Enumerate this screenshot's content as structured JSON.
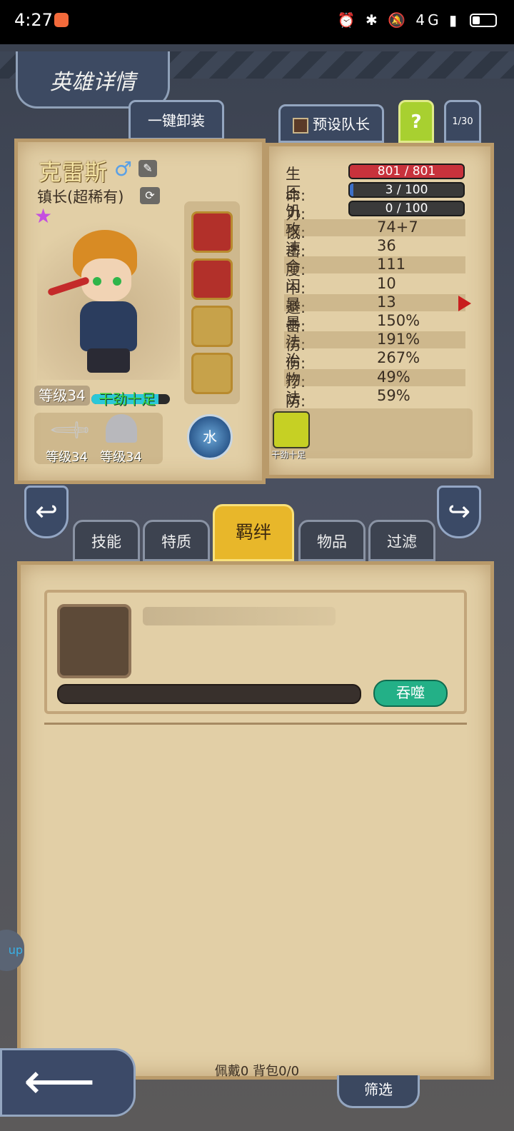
{
  "status_bar": {
    "time": "4:27",
    "icons": "⏰ ✱ 🔕 4G ▮",
    "battery_label": ""
  },
  "header": {
    "title": "英雄详情"
  },
  "buttons": {
    "unequip_all": "一键卸装",
    "preset_leader": "预设队长",
    "help": "?",
    "page_counter": "1/30",
    "devour": "吞噬",
    "filter": "筛选"
  },
  "hero": {
    "name": "克雷斯",
    "class": "镇长(超稀有)",
    "level": "等级34",
    "mood": "干劲十足",
    "mood_level": 0.85,
    "weapon_level": "等级34",
    "armor_level": "等级34",
    "element": "水"
  },
  "stats": {
    "bars": [
      {
        "label": "生命:",
        "text": "801 / 801",
        "fraction": 1.0,
        "color": "#c8323c"
      },
      {
        "label": "压力:",
        "text": "3 / 100",
        "fraction": 0.03,
        "color": "#3c6fc8"
      },
      {
        "label": "饥饿:",
        "text": "0 / 100",
        "fraction": 0.0,
        "color": "#3c6fc8"
      }
    ],
    "rows": [
      {
        "label": "攻击:",
        "value": "74+7"
      },
      {
        "label": "速度:",
        "value": "36"
      },
      {
        "label": "命中:",
        "value": "111"
      },
      {
        "label": "闪避:",
        "value": "10"
      },
      {
        "label": "暴击:",
        "value": "13"
      },
      {
        "label": "暴伤:",
        "value": "150%"
      },
      {
        "label": "法伤:",
        "value": "191%"
      },
      {
        "label": "治疗:",
        "value": "267%"
      },
      {
        "label": "物防:",
        "value": "49%"
      },
      {
        "label": "法防:",
        "value": "59%"
      }
    ]
  },
  "trait": {
    "label": "干劲十足"
  },
  "tabs": [
    {
      "label": "技能"
    },
    {
      "label": "特质"
    },
    {
      "label": "羁绊",
      "active": true
    },
    {
      "label": "物品"
    },
    {
      "label": "过滤"
    }
  ],
  "footer": {
    "count": "佩戴0 背包0/0"
  },
  "colors": {
    "parchment": "#e2cfa6",
    "active_tab": "#e8b72a",
    "devour": "#23b087"
  }
}
